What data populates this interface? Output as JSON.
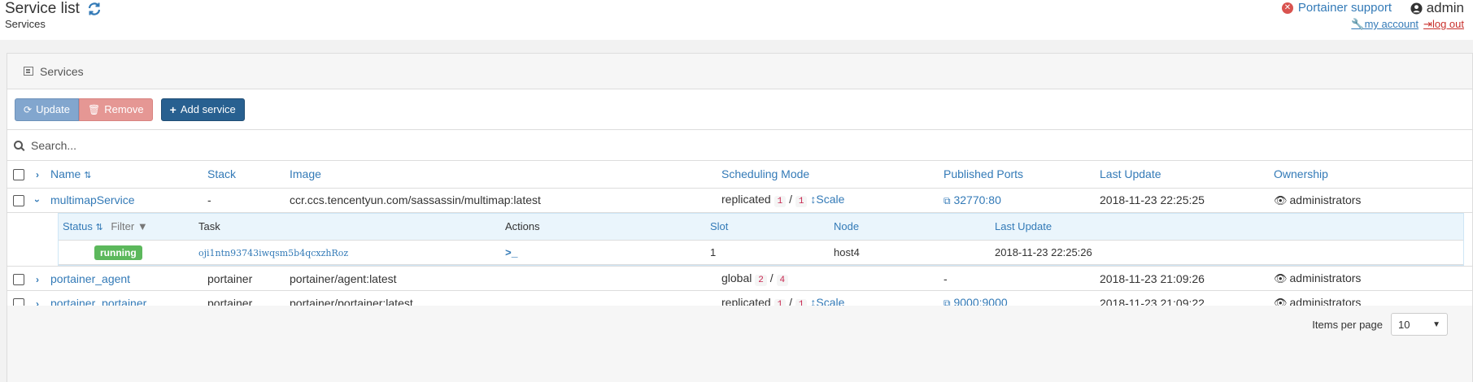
{
  "header": {
    "title": "Service list",
    "breadcrumb": "Services",
    "support_label": "Portainer support",
    "user_name": "admin",
    "my_account_label": "my account",
    "logout_label": "log out"
  },
  "widget": {
    "title": "Services",
    "buttons": {
      "update": "Update",
      "remove": "Remove",
      "add": "Add service"
    },
    "search_placeholder": "Search...",
    "columns": [
      "Name",
      "Stack",
      "Image",
      "Scheduling Mode",
      "Published Ports",
      "Last Update",
      "Ownership"
    ],
    "rows": [
      {
        "name": "multimapService",
        "stack": "-",
        "image": "ccr.ccs.tencentyun.com/sassassin/multimap:latest",
        "mode": "replicated",
        "running": "1",
        "desired": "1",
        "scale_label": "Scale",
        "ports": "32770:80",
        "last_update": "2018-11-23 22:25:25",
        "ownership": "administrators"
      },
      {
        "name": "portainer_agent",
        "stack": "portainer",
        "image": "portainer/agent:latest",
        "mode": "global",
        "running": "2",
        "desired": "4",
        "ports": "-",
        "last_update": "2018-11-23 21:09:26",
        "ownership": "administrators"
      },
      {
        "name": "portainer_portainer",
        "stack": "portainer",
        "image": "portainer/portainer:latest",
        "mode": "replicated",
        "running": "1",
        "desired": "1",
        "scale_label": "Scale",
        "ports": "9000:9000",
        "last_update": "2018-11-23 21:09:22",
        "ownership": "administrators"
      }
    ],
    "tasks": {
      "columns": [
        "Status",
        "Filter",
        "Task",
        "Actions",
        "Slot",
        "Node",
        "Last Update"
      ],
      "rows": [
        {
          "status": "running",
          "task_id": "oji1ntn93743iwqsm5b4qcxzhRoz",
          "action": ">_",
          "slot": "1",
          "node": "host4",
          "last_update": "2018-11-23 22:25:26"
        }
      ]
    },
    "pagination": {
      "label": "Items per page",
      "value": "10"
    }
  }
}
